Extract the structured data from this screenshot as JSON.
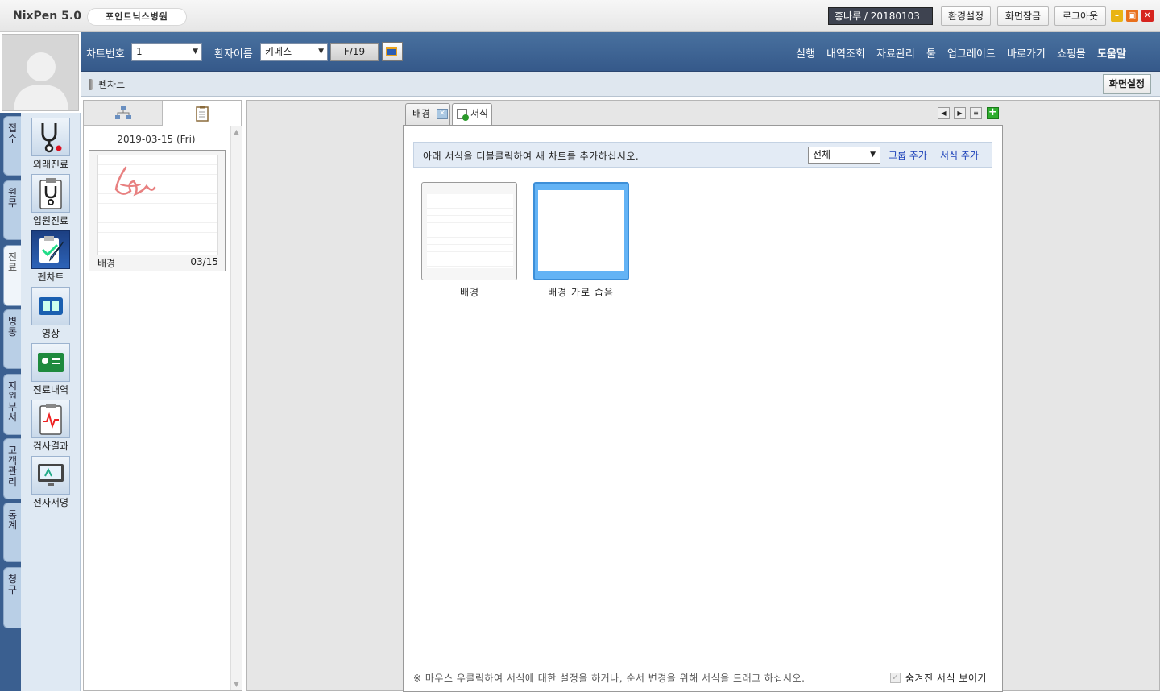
{
  "app": {
    "title": "NixPen 5.0",
    "hospital": "포인트닉스병원"
  },
  "titlebar": {
    "user": "홍나루 / 20180103",
    "buttons": [
      "환경설정",
      "화면잠금",
      "로그아웃"
    ]
  },
  "vtabs": [
    "접수",
    "원무",
    "진료",
    "병동",
    "지원부서",
    "고객관리",
    "통계",
    "청구"
  ],
  "active_vtab": "진료",
  "icon_menu": [
    "외래진료",
    "입원진료",
    "펜차트",
    "영상",
    "진료내역",
    "검사결과",
    "전자서명"
  ],
  "toolbar": {
    "chart_no_label": "차트번호",
    "chart_no_value": "1",
    "patient_label": "환자이름",
    "patient_value": "키메스",
    "fbox": "F/19",
    "menu": [
      "실행",
      "내역조회",
      "자료관리",
      "툴",
      "업그레이드",
      "바로가기",
      "쇼핑몰",
      "도움말"
    ]
  },
  "subbar": {
    "title": "펜차트",
    "screen_settings": "화면설정"
  },
  "left_panel": {
    "date": "2019-03-15 (Fri)",
    "thumb": {
      "label": "배경",
      "date": "03/15"
    }
  },
  "main": {
    "tabs": [
      {
        "label": "배경"
      },
      {
        "label": "서식"
      }
    ],
    "info_text": "아래 서식을 더블클릭하여 새 차트를 추가하십시오.",
    "filter_value": "전체",
    "link_group": "그룹 추가",
    "link_form": "서식 추가",
    "forms": [
      {
        "label": "배경"
      },
      {
        "label": "배경 가로 좁음"
      }
    ],
    "footnote": "※ 마우스 우클릭하여 서식에 대한 설정을 하거나, 순서 변경을 위해 서식을 드래그 하십시오.",
    "show_hidden_label": "숨겨진 서식 보이기"
  }
}
